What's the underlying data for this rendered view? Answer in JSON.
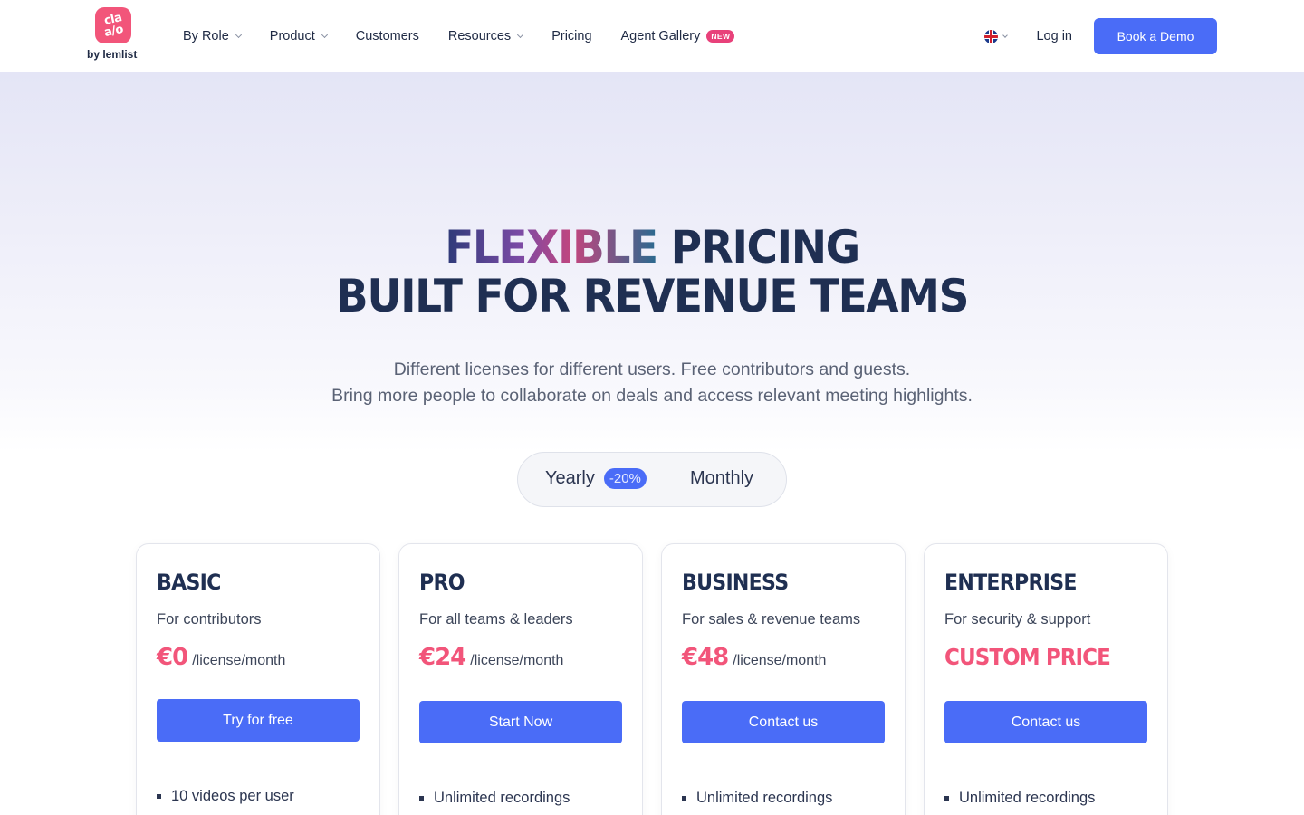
{
  "nav": {
    "logo_text_1": "cla",
    "logo_text_2": "a/o",
    "logo_sub": "by lemlist",
    "items": [
      {
        "label": "By Role",
        "dropdown": true
      },
      {
        "label": "Product",
        "dropdown": true
      },
      {
        "label": "Customers",
        "dropdown": false
      },
      {
        "label": "Resources",
        "dropdown": true
      },
      {
        "label": "Pricing",
        "dropdown": false
      },
      {
        "label": "Agent Gallery",
        "dropdown": false
      }
    ],
    "new_badge": "NEW",
    "language_icon": "uk-flag-icon",
    "login": "Log in",
    "demo_button": "Book a Demo"
  },
  "hero": {
    "title_highlight": "FLEXIBLE",
    "title_rest": " PRICING",
    "title_line2": "BUILT FOR REVENUE TEAMS",
    "subtitle_1": "Different licenses for different users. Free contributors and guests.",
    "subtitle_2": "Bring more people to collaborate on deals and access relevant meeting highlights."
  },
  "billing_toggle": {
    "yearly": "Yearly",
    "discount": "-20%",
    "monthly": "Monthly"
  },
  "plans": [
    {
      "name": "BASIC",
      "desc": "For contributors",
      "price": "€0",
      "unit": "/license/month",
      "cta": "Try for free",
      "feature": "10 videos per user"
    },
    {
      "name": "PRO",
      "desc": "For all teams & leaders",
      "price": "€24",
      "unit": "/license/month",
      "cta": "Start Now",
      "feature": "Unlimited recordings"
    },
    {
      "name": "BUSINESS",
      "desc": "For sales & revenue teams",
      "price": "€48",
      "unit": "/license/month",
      "cta": "Contact us",
      "feature": "Unlimited recordings"
    },
    {
      "name": "ENTERPRISE",
      "desc": "For security & support",
      "custom_price": "CUSTOM PRICE",
      "cta": "Contact us",
      "feature": "Unlimited recordings"
    }
  ],
  "colors": {
    "accent": "#4a6cf7",
    "brand_pink": "#f2557a",
    "heading": "#1f2f52"
  }
}
